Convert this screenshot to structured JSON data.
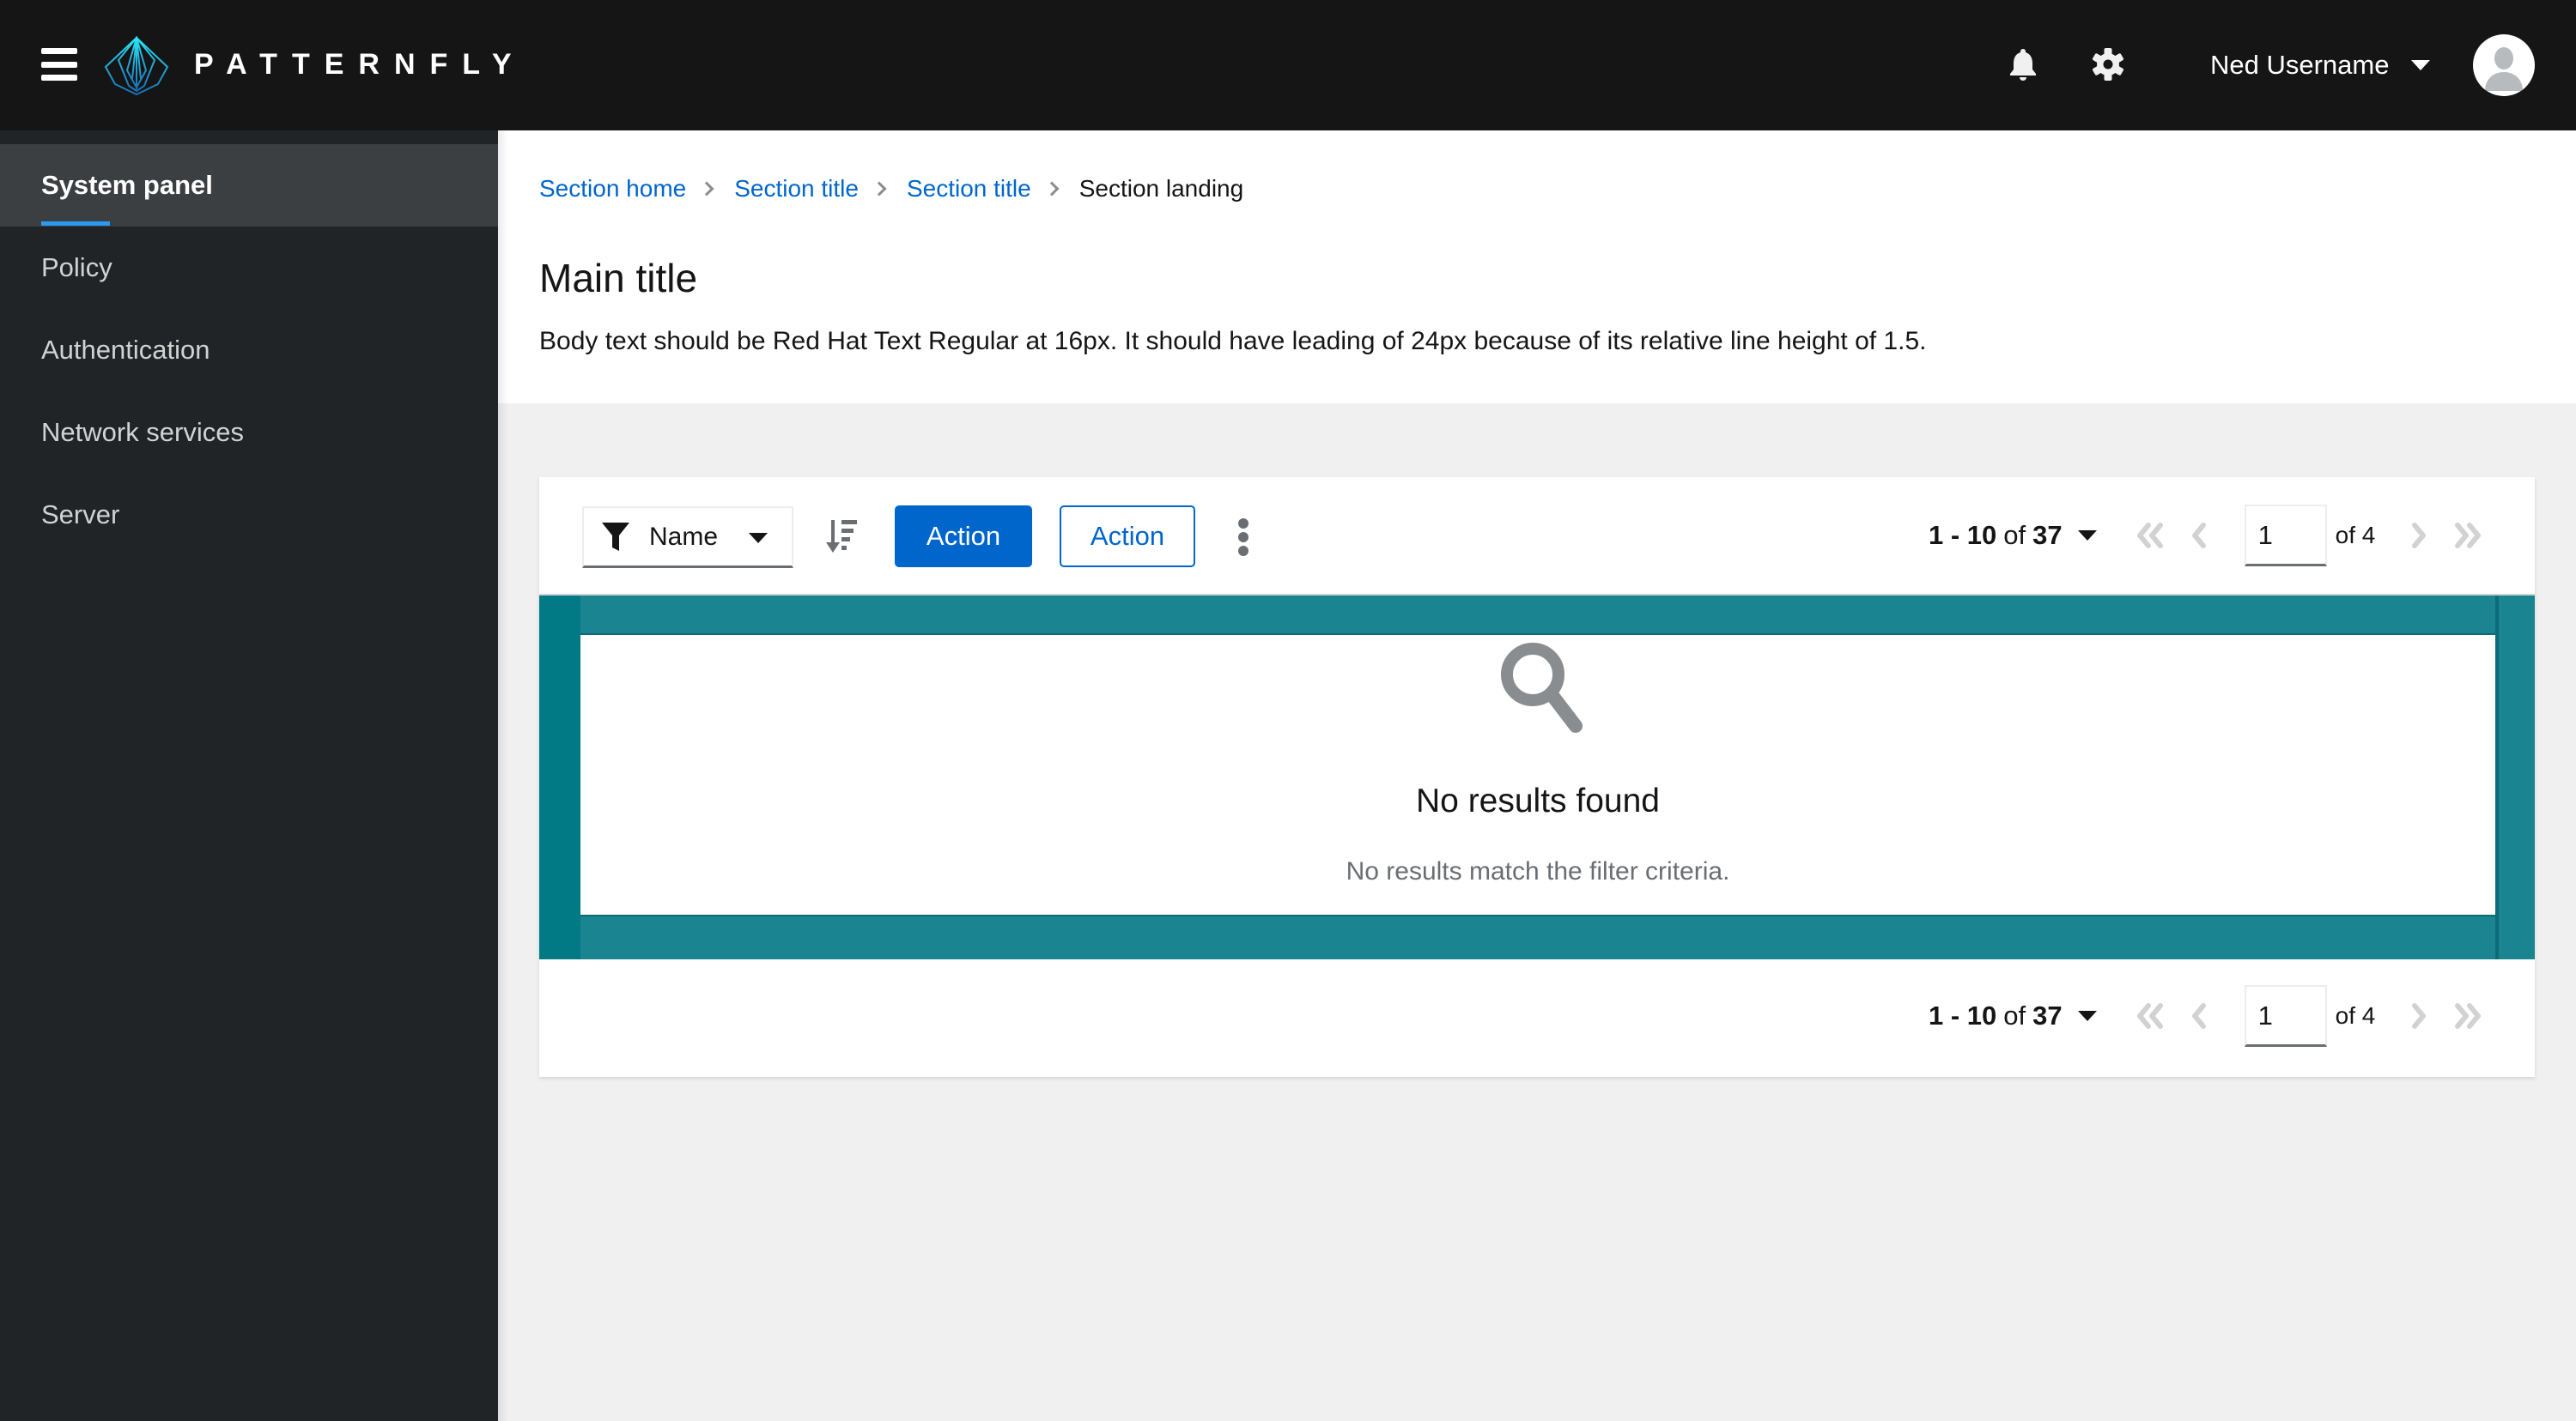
{
  "header": {
    "brand": "PATTERNFLY",
    "icons": [
      "menu-icon",
      "bell-icon",
      "gear-icon"
    ],
    "user_name": "Ned Username"
  },
  "sidebar": {
    "items": [
      {
        "label": "System panel",
        "active": true
      },
      {
        "label": "Policy",
        "active": false
      },
      {
        "label": "Authentication",
        "active": false
      },
      {
        "label": "Network services",
        "active": false
      },
      {
        "label": "Server",
        "active": false
      }
    ]
  },
  "breadcrumb": {
    "items": [
      {
        "label": "Section home",
        "link": true
      },
      {
        "label": "Section title",
        "link": true
      },
      {
        "label": "Section title",
        "link": true
      },
      {
        "label": "Section landing",
        "link": false
      }
    ]
  },
  "page": {
    "title": "Main title",
    "body": "Body text should be Red Hat Text Regular at 16px. It should have leading of 24px because of its relative line height of 1.5."
  },
  "toolbar": {
    "filter_label": "Name",
    "primary_action": "Action",
    "secondary_action": "Action"
  },
  "pagination": {
    "range_start_end": "1 - 10",
    "of_label": "of",
    "total": "37",
    "current_page": "1",
    "page_count_label": "of 4"
  },
  "empty_state": {
    "title": "No results found",
    "body": "No results match the filter criteria."
  },
  "colors": {
    "header_bg": "#151515",
    "sidebar_bg": "#212427",
    "sidebar_active_bg": "#3c3f42",
    "accent_blue": "#0066cc",
    "active_indicator": "#2b9af3",
    "teal_highlight": "#1a8591",
    "page_bg": "#f0f0f0"
  }
}
